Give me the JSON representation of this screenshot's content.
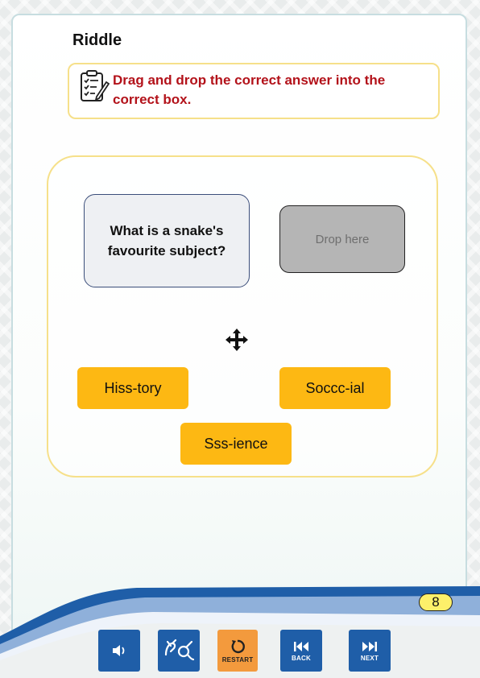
{
  "activity": {
    "title": "Riddle",
    "instruction": "Drag and drop the correct answer into the correct box.",
    "question": "What is a snake's favourite subject?",
    "drop_placeholder": "Drop here",
    "answers": [
      {
        "label": "Hiss-tory"
      },
      {
        "label": "Soccc-ial"
      },
      {
        "label": "Sss-ience"
      }
    ]
  },
  "footer": {
    "page_number": "8",
    "buttons": {
      "audio_icon": "speaker-icon",
      "sign_icon": "sign-language-icon",
      "restart_label": "RESTART",
      "back_label": "BACK",
      "next_label": "NEXT"
    }
  },
  "colors": {
    "accent_blue": "#1f5ea8",
    "answer_yellow": "#fdb813",
    "instruction_red": "#b3121a",
    "restart_orange": "#f39a3d",
    "border_yellow": "#f6e08a"
  }
}
